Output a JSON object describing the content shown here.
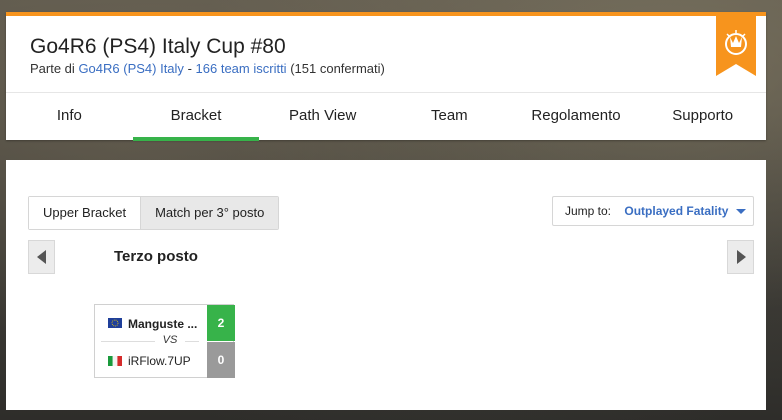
{
  "header": {
    "title": "Go4R6 (PS4) Italy Cup #80",
    "subtitle_prefix": "Parte di",
    "league_link": "Go4R6 (PS4) Italy",
    "separator": "-",
    "teams_link": "166 team iscritti",
    "confirmed": "(151 confermati)",
    "accent_color": "#f7941d",
    "badge_icon": "trophy-ribbon-icon"
  },
  "tabs": [
    {
      "label": "Info",
      "active": false
    },
    {
      "label": "Bracket",
      "active": true
    },
    {
      "label": "Path View",
      "active": false
    },
    {
      "label": "Team",
      "active": false
    },
    {
      "label": "Regolamento",
      "active": false
    },
    {
      "label": "Supporto",
      "active": false
    }
  ],
  "active_tab_color": "#37b34a",
  "bracket": {
    "segments": [
      {
        "label": "Upper Bracket",
        "selected": false
      },
      {
        "label": "Match per 3° posto",
        "selected": true
      }
    ],
    "jump_label": "Jump to:",
    "jump_value": "Outplayed Fatality",
    "round_title": "Terzo posto",
    "match": {
      "team1": {
        "name": "Manguste ...",
        "score": "2",
        "flag_icon": "eu-flag-icon",
        "score_color": "#37b34a"
      },
      "vs_label": "VS",
      "team2": {
        "name": "iRFlow.7UP",
        "score": "0",
        "flag_icon": "italy-flag-icon",
        "score_color": "#9a9a9a"
      }
    }
  }
}
